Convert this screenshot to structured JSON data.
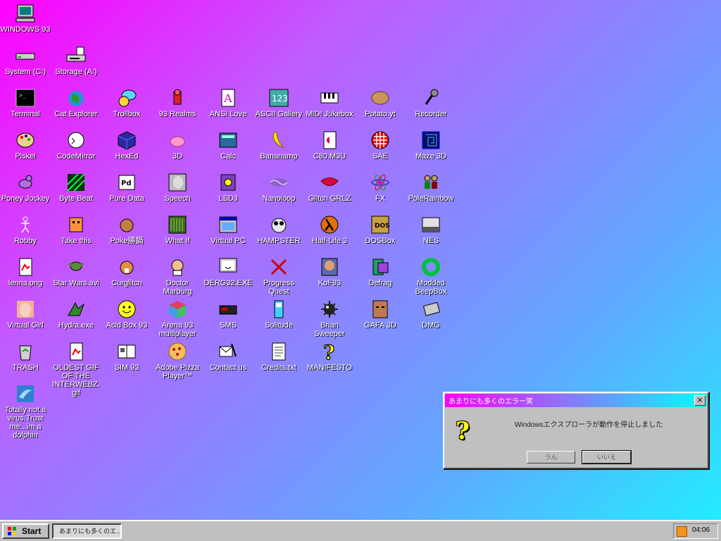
{
  "desktop": {
    "icons": [
      {
        "label": "WINDOWS 93",
        "icon": "computer-icon"
      },
      {
        "label": "System (C:)",
        "icon": "drive-icon"
      },
      {
        "label": "Storage (A:)",
        "icon": "floppy-drive-icon"
      },
      {
        "label": "Terminal",
        "icon": "terminal-icon"
      },
      {
        "label": "Cat Explorer",
        "icon": "cat-globe-icon"
      },
      {
        "label": "Trollbox",
        "icon": "chat-icon"
      },
      {
        "label": "93 Realms",
        "icon": "knight-icon"
      },
      {
        "label": "ANSI Love",
        "icon": "ansi-icon"
      },
      {
        "label": "ASCII Gallery",
        "icon": "ascii-icon"
      },
      {
        "label": "MIDI Jukebox",
        "icon": "piano-icon"
      },
      {
        "label": "Potato.yt",
        "icon": "potato-icon"
      },
      {
        "label": "Recorder",
        "icon": "microphone-icon"
      },
      {
        "label": "Piskel",
        "icon": "palette-icon"
      },
      {
        "label": "CodeMirror",
        "icon": "cat-code-icon"
      },
      {
        "label": "HexEd",
        "icon": "cube-icon"
      },
      {
        "label": "3D",
        "icon": "teapot-icon"
      },
      {
        "label": "Calc",
        "icon": "calculator-icon"
      },
      {
        "label": "Bananamp",
        "icon": "banana-icon"
      },
      {
        "label": "C80.M3U",
        "icon": "audio-file-icon"
      },
      {
        "label": "SAE",
        "icon": "ball-icon"
      },
      {
        "label": "Maze 3D",
        "icon": "maze-icon"
      },
      {
        "label": "Poney Jockey",
        "icon": "pony-icon"
      },
      {
        "label": "Byte Beat",
        "icon": "bytebeat-icon"
      },
      {
        "label": "Pure Data",
        "icon": "puredata-icon"
      },
      {
        "label": "Speech",
        "icon": "face-icon"
      },
      {
        "label": "LSDJ",
        "icon": "lsdj-icon"
      },
      {
        "label": "Nanoloop",
        "icon": "wave-icon"
      },
      {
        "label": "Glitch GRLZ",
        "icon": "lips-icon"
      },
      {
        "label": "FX",
        "icon": "atom-icon"
      },
      {
        "label": "PoleRainbow",
        "icon": "people-icon"
      },
      {
        "label": "Robby",
        "icon": "stickman-icon"
      },
      {
        "label": "Take this",
        "icon": "creature-icon"
      },
      {
        "label": "Poke勝鍋",
        "icon": "pokemon-icon"
      },
      {
        "label": "What If",
        "icon": "whatif-icon"
      },
      {
        "label": "Virtual PC",
        "icon": "window-icon"
      },
      {
        "label": "HAMPSTER",
        "icon": "owl-icon"
      },
      {
        "label": "Half-Life 3",
        "icon": "lambda-icon"
      },
      {
        "label": "DOSBox",
        "icon": "dosbox-icon"
      },
      {
        "label": "NES",
        "icon": "nes-icon"
      },
      {
        "label": "lenna.png",
        "icon": "image-file-icon"
      },
      {
        "label": "Star Wars.avi",
        "icon": "yoda-icon"
      },
      {
        "label": "Curglitch",
        "icon": "corgi-icon"
      },
      {
        "label": "Doctor Marburg",
        "icon": "doctor-icon"
      },
      {
        "label": "DERG32.EXE",
        "icon": "monitor-face-icon"
      },
      {
        "label": "Progress Quest",
        "icon": "swords-icon"
      },
      {
        "label": "KoF93",
        "icon": "fighter-icon"
      },
      {
        "label": "Defrag",
        "icon": "defrag-icon"
      },
      {
        "label": "Modded BeepBox",
        "icon": "ring-icon"
      },
      {
        "label": "Virtual Girl",
        "icon": "girl-icon"
      },
      {
        "label": "Hydra.exe",
        "icon": "dragon-icon"
      },
      {
        "label": "Acid Box 93",
        "icon": "smiley-icon"
      },
      {
        "label": "Arena 93 multiplayer",
        "icon": "arena-cube-icon"
      },
      {
        "label": "SMS",
        "icon": "console-icon"
      },
      {
        "label": "Solitude",
        "icon": "solitude-icon"
      },
      {
        "label": "Brian Sweeper",
        "icon": "mine-icon"
      },
      {
        "label": "GAFA 3D",
        "icon": "doomguy-icon"
      },
      {
        "label": "DMG",
        "icon": "gameboy-icon"
      },
      {
        "label": "TRASH",
        "icon": "trash-icon"
      },
      {
        "label": "OLDEST GIF OF THE INTERWEBZ.gif",
        "icon": "image-file-icon"
      },
      {
        "label": "SIM 93",
        "icon": "book-icon"
      },
      {
        "label": "Adobe Pizza Player™",
        "icon": "pizza-icon"
      },
      {
        "label": "Contact us",
        "icon": "contact-icon"
      },
      {
        "label": "Credits.txt",
        "icon": "text-file-icon"
      },
      {
        "label": "MANIFESTO",
        "icon": "question-icon"
      },
      {
        "label": "Totally not a virus.Trust me...im a dolphin",
        "icon": "dolphin-icon"
      }
    ]
  },
  "dialog": {
    "title": "あまりにも多くのエラー笑",
    "message": "Windowsエクスプローラが動作を停止しました",
    "yes_label": "うん",
    "no_label": "いいえ",
    "close_glyph": "×",
    "icon": "question-icon"
  },
  "taskbar": {
    "start_label": "Start",
    "task_label": "あまりにも多くのエ...",
    "clock": "04:06",
    "tray_icon": "rss-icon"
  }
}
